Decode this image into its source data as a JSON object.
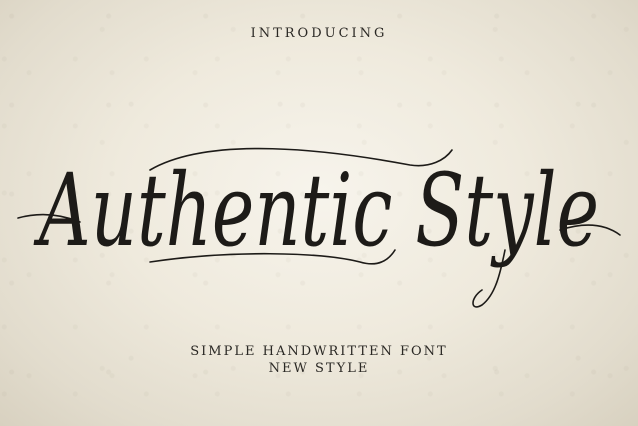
{
  "eyebrow": "INTRODUCING",
  "title": "Authentic Style",
  "subtitle": {
    "line1": "SIMPLE HANDWRITTEN FONT",
    "line2": "NEW STYLE"
  },
  "colors": {
    "ink": "#1d1b18",
    "paper": "#efeadd"
  }
}
